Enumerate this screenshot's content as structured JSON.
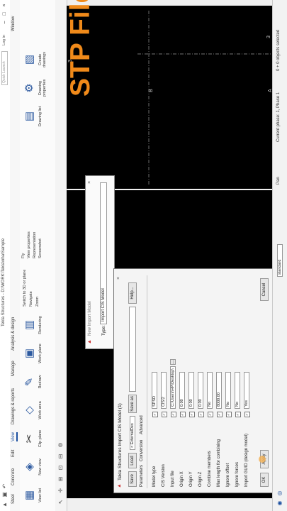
{
  "app": {
    "title": "Tekla Structures - D:\\WORK\\Tekla\\nha\\Sample",
    "quick_launch": "Quick Launch",
    "login": "Log in",
    "window_menu": "Window"
  },
  "tabs": [
    "Steel",
    "Concrete",
    "Edit",
    "View",
    "Drawings & reports",
    "Manage",
    "Analysis & design"
  ],
  "active_tab": "View",
  "ribbon": {
    "view_list": "View list",
    "new_view": "New view",
    "clip_plane": "Clip plane",
    "work_area": "Work area",
    "redraw": "Redraw",
    "work_plane": "Work plane",
    "rendering": "Rendering",
    "switch_3d": "Switch to 3D or plane",
    "navigate": "Navigate",
    "zoom": "Zoom",
    "fly": "Fly",
    "view_properties": "View properties",
    "representation": "Representation",
    "screenshot": "Screenshot",
    "drawing_list": "Drawing list",
    "drawing_properties": "Drawing properties",
    "create_drawings": "Create drawings"
  },
  "overlay_title": "STP File Import",
  "grid_labels": {
    "a": "A",
    "b": "B",
    "three_left": "3",
    "three_right": "3"
  },
  "new_import_dialog": {
    "title": "New Import Model",
    "type_label": "Type:",
    "type_value": "Import CIS Model"
  },
  "import_dialog": {
    "title": "Tekla Structures  Import CIS Model (1)",
    "save_button": "Save",
    "load_button": "Load",
    "load_value": "< ExternalDes",
    "save_as_button": "Save as",
    "help_button": "Help...",
    "subtabs": [
      "Parameters",
      "Conversion",
      "Advanced"
    ],
    "params": [
      {
        "label": "Model type",
        "checked": true,
        "value": "SPSD",
        "type": "select"
      },
      {
        "label": "CIS Version",
        "checked": true,
        "value": "CIS/2",
        "type": "select"
      },
      {
        "label": "Input file",
        "checked": true,
        "value": "C:\\Users\\HP\\Desktop\\",
        "type": "file"
      },
      {
        "label": "Origin X",
        "checked": true,
        "value": "0.00",
        "type": "text"
      },
      {
        "label": "Origin Y",
        "checked": true,
        "value": "0.00",
        "type": "text"
      },
      {
        "label": "Origin Z",
        "checked": true,
        "value": "0.00",
        "type": "text"
      },
      {
        "label": "Combine members",
        "checked": true,
        "value": "No",
        "type": "select"
      },
      {
        "label": "Max length for combining",
        "checked": true,
        "value": "8000.00",
        "type": "text"
      },
      {
        "label": "Ignore offset",
        "checked": true,
        "value": "No",
        "type": "select"
      },
      {
        "label": "Ignore forces",
        "checked": true,
        "value": "No",
        "type": "select"
      },
      {
        "label": "Import GUID (design model)",
        "checked": true,
        "value": "Yes",
        "type": "select"
      }
    ],
    "ok_button": "OK",
    "apply_button": "Apply",
    "cancel_button": "Cancel"
  },
  "status_bar": {
    "standard": "standard",
    "pan": "Pan",
    "phase": "Current phase: 1, Phase 1",
    "selection": "0 + 0 objects selected"
  },
  "colors": {
    "accent": "#1b4fa0",
    "overlay_title": "#f08a1a",
    "viewport": "#000000",
    "grid_line": "#9a9a9a"
  }
}
